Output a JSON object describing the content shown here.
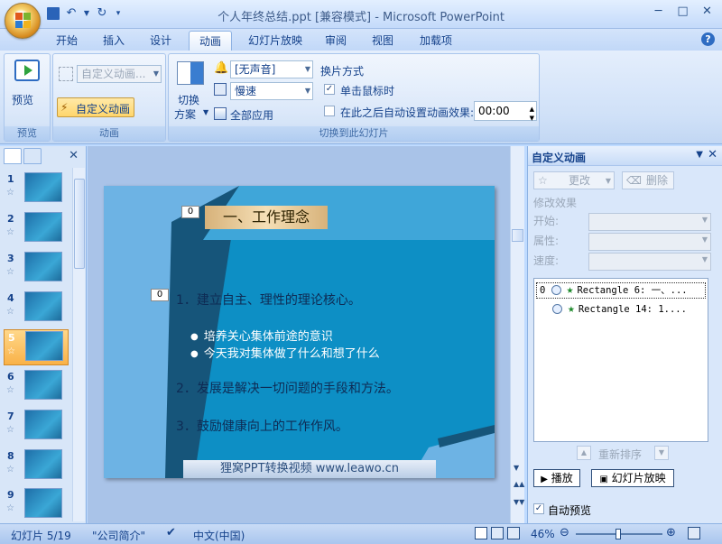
{
  "window": {
    "title": "个人年终总结.ppt [兼容模式] - Microsoft PowerPoint",
    "minimize_icon": "minimize-icon",
    "maximize_icon": "maximize-icon",
    "close_icon": "close-icon"
  },
  "tabs": [
    {
      "label": "开始"
    },
    {
      "label": "插入"
    },
    {
      "label": "设计"
    },
    {
      "label": "动画",
      "active": true
    },
    {
      "label": "幻灯片放映"
    },
    {
      "label": "审阅"
    },
    {
      "label": "视图"
    },
    {
      "label": "加载项"
    }
  ],
  "ribbon": {
    "preview": {
      "button_label": "预览",
      "group_label": "预览"
    },
    "animation": {
      "custom_anim_combo": "自定义动画...",
      "custom_anim_button": "自定义动画",
      "group_label": "动画"
    },
    "transition": {
      "scheme_label_line1": "切换",
      "scheme_label_line2": "方案",
      "sound_combo": "[无声音]",
      "speed_combo": "慢速",
      "apply_all": "全部应用",
      "advance_heading": "换片方式",
      "on_click": "单击鼠标时",
      "on_click_checked": true,
      "auto_after": "在此之后自动设置动画效果:",
      "auto_after_checked": false,
      "auto_time": "00:00",
      "group_label": "切换到此幻灯片"
    }
  },
  "thumbnails": {
    "items": [
      {
        "num": "1"
      },
      {
        "num": "2"
      },
      {
        "num": "3"
      },
      {
        "num": "4"
      },
      {
        "num": "5",
        "selected": true
      },
      {
        "num": "6"
      },
      {
        "num": "7"
      },
      {
        "num": "8"
      },
      {
        "num": "9"
      }
    ]
  },
  "slide": {
    "title": "一、工作理念",
    "title_tag": "0",
    "body_tag": "0",
    "point1": "1．建立自主、理性的理论核心。",
    "bullet1": "培养关心集体前途的意识",
    "bullet2": "今天我对集体做了什么和想了什么",
    "point2": "2．发展是解决一切问题的手段和方法。",
    "point3": "3．鼓励健康向上的工作作风。",
    "footer": "狸窝PPT转换视频  www.leawo.cn",
    "bg_color": "#0d8fc5"
  },
  "task_pane": {
    "title": "自定义动画",
    "change_button": "更改",
    "delete_button": "删除",
    "modify_heading": "修改效果",
    "start_label": "开始:",
    "property_label": "属性:",
    "speed_label": "速度:",
    "anim_items": [
      {
        "order": "0",
        "text": "Rectangle 6: 一、..."
      },
      {
        "order": "",
        "text": "Rectangle 14: 1...."
      }
    ],
    "reorder_label": "重新排序",
    "play_button": "播放",
    "slideshow_button": "幻灯片放映",
    "auto_preview": "自动预览",
    "auto_preview_checked": true
  },
  "status": {
    "slide_info": "幻灯片 5/19",
    "theme": "\"公司简介\"",
    "language": "中文(中国)",
    "zoom": "46%"
  }
}
